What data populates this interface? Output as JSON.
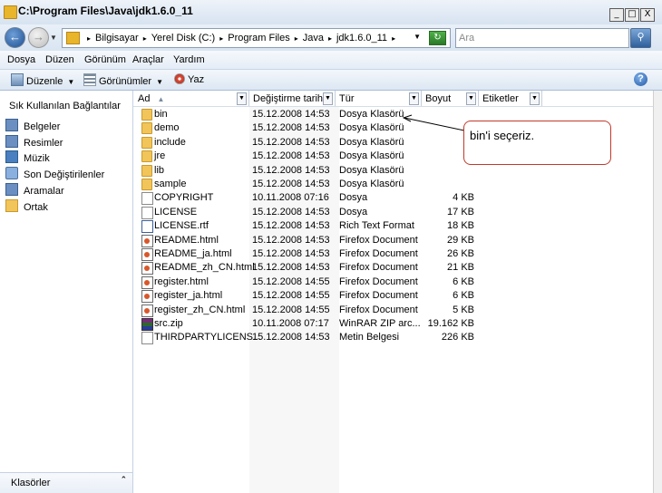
{
  "window": {
    "title": "C:\\Program Files\\Java\\jdk1.6.0_11",
    "min": "_",
    "max": "□",
    "close": "X"
  },
  "address": {
    "crumbs": [
      "Bilgisayar",
      "Yerel Disk (C:)",
      "Program Files",
      "Java",
      "jdk1.6.0_11"
    ],
    "search_placeholder": "Ara"
  },
  "menu": [
    "Dosya",
    "Düzen",
    "Görünüm",
    "Araçlar",
    "Yardım"
  ],
  "toolbar": {
    "organize": "Düzenle",
    "views": "Görünümler",
    "burn": "Yaz",
    "help": "?"
  },
  "nav": {
    "header": "Sık Kullanılan Bağlantılar",
    "items": [
      {
        "label": "Belgeler",
        "icon": "documents-icon"
      },
      {
        "label": "Resimler",
        "icon": "pictures-icon"
      },
      {
        "label": "Müzik",
        "icon": "music-icon"
      },
      {
        "label": "Son Değiştirilenler",
        "icon": "recent-icon"
      },
      {
        "label": "Aramalar",
        "icon": "searches-icon"
      },
      {
        "label": "Ortak",
        "icon": "folder-icon"
      }
    ],
    "footer": "Klasörler"
  },
  "columns": {
    "name": "Ad",
    "date": "Değiştirme tarihi",
    "type": "Tür",
    "size": "Boyut",
    "tags": "Etiketler"
  },
  "files": [
    {
      "name": "bin",
      "date": "15.12.2008 14:53",
      "type": "Dosya Klasörü",
      "size": "",
      "icon": "folder"
    },
    {
      "name": "demo",
      "date": "15.12.2008 14:53",
      "type": "Dosya Klasörü",
      "size": "",
      "icon": "folder"
    },
    {
      "name": "include",
      "date": "15.12.2008 14:53",
      "type": "Dosya Klasörü",
      "size": "",
      "icon": "folder"
    },
    {
      "name": "jre",
      "date": "15.12.2008 14:53",
      "type": "Dosya Klasörü",
      "size": "",
      "icon": "folder"
    },
    {
      "name": "lib",
      "date": "15.12.2008 14:53",
      "type": "Dosya Klasörü",
      "size": "",
      "icon": "folder"
    },
    {
      "name": "sample",
      "date": "15.12.2008 14:53",
      "type": "Dosya Klasörü",
      "size": "",
      "icon": "folder"
    },
    {
      "name": "COPYRIGHT",
      "date": "10.11.2008 07:16",
      "type": "Dosya",
      "size": "4 KB",
      "icon": "doc"
    },
    {
      "name": "LICENSE",
      "date": "15.12.2008 14:53",
      "type": "Dosya",
      "size": "17 KB",
      "icon": "doc"
    },
    {
      "name": "LICENSE.rtf",
      "date": "15.12.2008 14:53",
      "type": "Rich Text Format",
      "size": "18 KB",
      "icon": "rtf"
    },
    {
      "name": "README.html",
      "date": "15.12.2008 14:53",
      "type": "Firefox Document",
      "size": "29 KB",
      "icon": "html"
    },
    {
      "name": "README_ja.html",
      "date": "15.12.2008 14:53",
      "type": "Firefox Document",
      "size": "26 KB",
      "icon": "html"
    },
    {
      "name": "README_zh_CN.html",
      "date": "15.12.2008 14:53",
      "type": "Firefox Document",
      "size": "21 KB",
      "icon": "html"
    },
    {
      "name": "register.html",
      "date": "15.12.2008 14:55",
      "type": "Firefox Document",
      "size": "6 KB",
      "icon": "html"
    },
    {
      "name": "register_ja.html",
      "date": "15.12.2008 14:55",
      "type": "Firefox Document",
      "size": "6 KB",
      "icon": "html"
    },
    {
      "name": "register_zh_CN.html",
      "date": "15.12.2008 14:55",
      "type": "Firefox Document",
      "size": "5 KB",
      "icon": "html"
    },
    {
      "name": "src.zip",
      "date": "10.11.2008 07:17",
      "type": "WinRAR ZIP arc...",
      "size": "19.162 KB",
      "icon": "zip"
    },
    {
      "name": "THIRDPARTYLICENS...",
      "date": "15.12.2008 14:53",
      "type": "Metin Belgesi",
      "size": "226 KB",
      "icon": "doc"
    }
  ],
  "callout": {
    "text": "bin'i seçeriz."
  }
}
